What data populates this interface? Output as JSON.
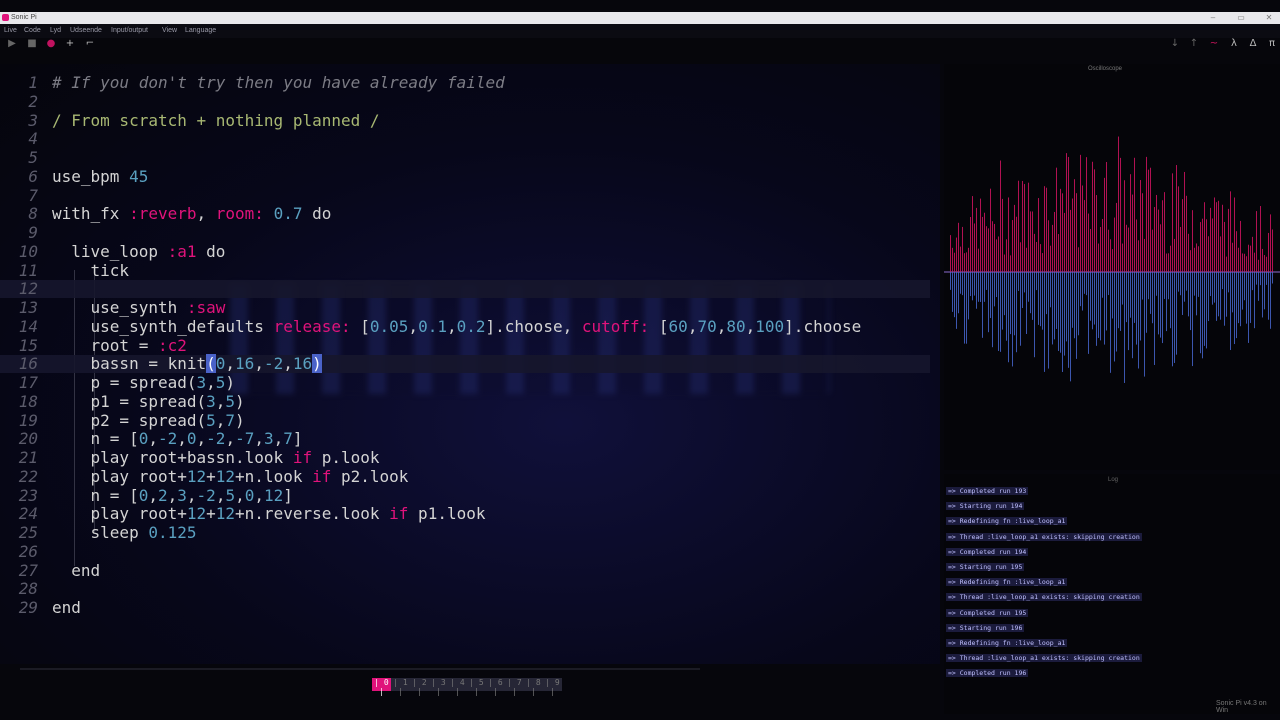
{
  "window": {
    "title": "Sonic Pi",
    "min": "–",
    "max": "▭",
    "close": "✕"
  },
  "menu": [
    "Live",
    "Code",
    "Lyd",
    "Udseende",
    "Input/output",
    "View",
    "Language"
  ],
  "toolbar": {
    "run": "▶",
    "stop": "■",
    "rec": "●",
    "add": "+",
    "undo": "⌐",
    "right": [
      "↓",
      "↑",
      "~",
      "λ",
      "Δ",
      "π"
    ]
  },
  "editor": {
    "lines": [
      {
        "n": "1",
        "html": "<span class=\"cmt\"># If you don't try then you have already failed</span>"
      },
      {
        "n": "2",
        "html": ""
      },
      {
        "n": "3",
        "html": "<span class=\"cmt\" style=\"font-style:normal;color:#a8b873\">/ From scratch + nothing planned /</span>"
      },
      {
        "n": "4",
        "html": ""
      },
      {
        "n": "5",
        "html": ""
      },
      {
        "n": "6",
        "html": "use_bpm <span class=\"num-c\">45</span>"
      },
      {
        "n": "7",
        "html": ""
      },
      {
        "n": "8",
        "html": "with_fx <span class=\"sym\">:reverb</span>, <span class=\"key\">room:</span> <span class=\"num-c\">0.7</span> do"
      },
      {
        "n": "9",
        "html": ""
      },
      {
        "n": "10",
        "html": "  live_loop <span class=\"sym\">:a1</span> do"
      },
      {
        "n": "11",
        "html": "    tick"
      },
      {
        "n": "12",
        "html": ""
      },
      {
        "n": "13",
        "html": "    use_synth <span class=\"sym\">:saw</span>"
      },
      {
        "n": "14",
        "html": "    use_synth_defaults <span class=\"key\">release:</span> [<span class=\"num-c\">0.05</span>,<span class=\"num-c\">0.1</span>,<span class=\"num-c\">0.2</span>].choose, <span class=\"key\">cutoff:</span> [<span class=\"num-c\">60</span>,<span class=\"num-c\">70</span>,<span class=\"num-c\">80</span>,<span class=\"num-c\">100</span>].choose"
      },
      {
        "n": "15",
        "html": "    root = <span class=\"sym\">:c2</span>"
      },
      {
        "n": "16",
        "html": "    bassn = knit<span class=\"paren\">(</span><span class=\"num-c\">0</span>,<span class=\"num-c\">16</span>,<span class=\"num-c\">-2</span>,<span class=\"num-c\">16</span><span class=\"paren\">)</span>"
      },
      {
        "n": "17",
        "html": "    p = spread(<span class=\"num-c\">3</span>,<span class=\"num-c\">5</span>)"
      },
      {
        "n": "18",
        "html": "    p1 = spread(<span class=\"num-c\">3</span>,<span class=\"num-c\">5</span>)"
      },
      {
        "n": "19",
        "html": "    p2 = spread(<span class=\"num-c\">5</span>,<span class=\"num-c\">7</span>)"
      },
      {
        "n": "20",
        "html": "    n = [<span class=\"num-c\">0</span>,<span class=\"num-c\">-2</span>,<span class=\"num-c\">0</span>,<span class=\"num-c\">-2</span>,<span class=\"num-c\">-7</span>,<span class=\"num-c\">3</span>,<span class=\"num-c\">7</span>]"
      },
      {
        "n": "21",
        "html": "    play root+bassn.look <span class=\"key\">if</span> p.look"
      },
      {
        "n": "22",
        "html": "    play root+<span class=\"num-c\">12</span>+<span class=\"num-c\">12</span>+n.look <span class=\"key\">if</span> p2.look"
      },
      {
        "n": "23",
        "html": "    n = [<span class=\"num-c\">0</span>,<span class=\"num-c\">2</span>,<span class=\"num-c\">3</span>,<span class=\"num-c\">-2</span>,<span class=\"num-c\">5</span>,<span class=\"num-c\">0</span>,<span class=\"num-c\">12</span>]"
      },
      {
        "n": "24",
        "html": "    play root+<span class=\"num-c\">12</span>+<span class=\"num-c\">12</span>+n.reverse.look <span class=\"key\">if</span> p1.look"
      },
      {
        "n": "25",
        "html": "    sleep <span class=\"num-c\">0.125</span>"
      },
      {
        "n": "26",
        "html": ""
      },
      {
        "n": "27",
        "html": "  end"
      },
      {
        "n": "28",
        "html": ""
      },
      {
        "n": "29",
        "html": "end"
      }
    ]
  },
  "scope": {
    "label": "Oscilloscope"
  },
  "log": {
    "label": "Log",
    "entries": [
      "=> Completed run 193",
      "=> Starting run 194",
      "=> Redefining fn :live_loop_a1",
      "=> Thread :live_loop_a1 exists: skipping creation",
      "=> Completed run 194",
      "=> Starting run 195",
      "=> Redefining fn :live_loop_a1",
      "=> Thread :live_loop_a1 exists: skipping creation",
      "=> Completed run 195",
      "=> Starting run 196",
      "=> Redefining fn :live_loop_a1",
      "=> Thread :live_loop_a1 exists: skipping creation",
      "=> Completed run 196"
    ]
  },
  "buffers": [
    "| 0 |",
    "| 1 |",
    "| 2 |",
    "| 3 |",
    "| 4 |",
    "| 5 |",
    "| 6 |",
    "| 7 |",
    "| 8 |",
    "| 9 |"
  ],
  "status": "Sonic Pi v4.3 on Win",
  "colors": {
    "accent": "#e0137b",
    "bg": "#06060c",
    "number": "#5aa0c0",
    "scopeTop": "#d0145f",
    "scopeBottom": "#4a6ad8"
  }
}
